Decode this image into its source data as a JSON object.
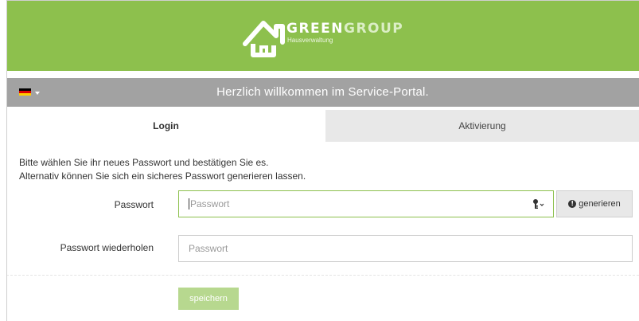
{
  "header": {
    "brand_primary": "GREEN",
    "brand_secondary": "GROUP",
    "brand_subtitle": "Hausverwaltung",
    "background_color": "#8dc04d",
    "logo_icon": "house-icon"
  },
  "welcome_bar": {
    "language_flag": "flag-de-icon",
    "title": "Herzlich willkommen im Service-Portal.",
    "background_color": "#a2a2a2"
  },
  "tabs": [
    {
      "label": "Login",
      "active": true
    },
    {
      "label": "Aktivierung",
      "active": false
    }
  ],
  "intro": {
    "line1": "Bitte wählen Sie ihr neues Passwort und bestätigen Sie es.",
    "line2": "Alternativ können Sie sich ein sicheres Passwort generieren lassen."
  },
  "form": {
    "password": {
      "label": "Passwort",
      "placeholder": "Passwort",
      "value": ""
    },
    "password_repeat": {
      "label": "Passwort wiederholen",
      "placeholder": "Passwort",
      "value": ""
    },
    "generate_button": "generieren",
    "key_icon": "key-icon",
    "save_button": "speichern",
    "save_color": "#b7d88f"
  }
}
